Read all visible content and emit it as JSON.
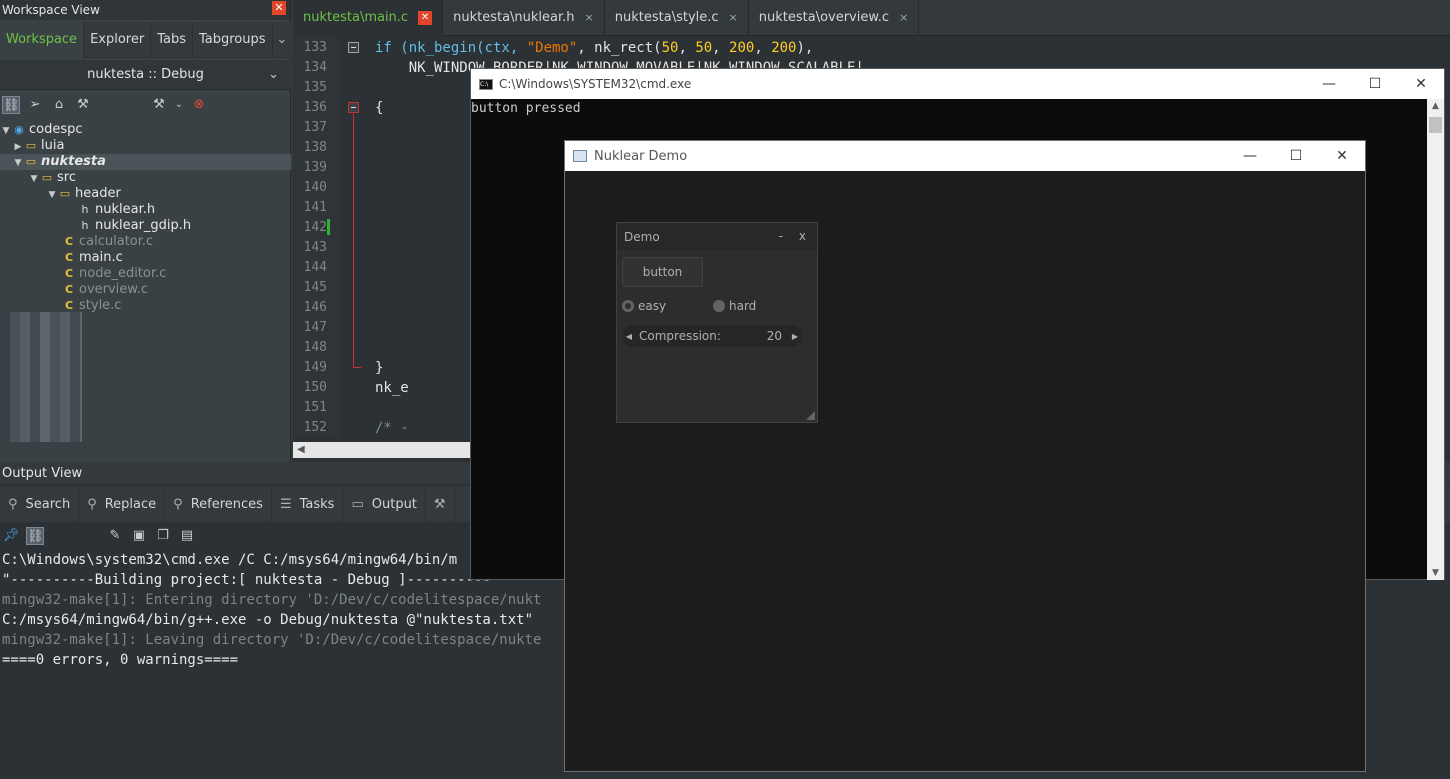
{
  "workspace": {
    "title": "Workspace View",
    "close_glyph": "✕",
    "tabs": [
      "Workspace",
      "Explorer",
      "Tabs",
      "Tabgroups"
    ],
    "tabs_more_glyph": "⌄",
    "project_selector": "nuktesta :: Debug",
    "project_selector_arrow": "⌄",
    "toolbar_icons": [
      "link-icon",
      "paper-plane-icon",
      "home-icon",
      "wrench-icon",
      "hammer-icon",
      "stop-icon"
    ],
    "tree": [
      {
        "label": "codespc",
        "icon": "project-icon",
        "expanded": true
      },
      {
        "label": "luia",
        "icon": "folder-icon",
        "expanded": false
      },
      {
        "label": "nuktesta",
        "icon": "folder-icon",
        "expanded": true
      },
      {
        "label": "src",
        "icon": "folder-icon",
        "expanded": true
      },
      {
        "label": "header",
        "icon": "folder-icon",
        "expanded": true
      },
      {
        "label": "nuklear.h",
        "icon": "h-file-icon"
      },
      {
        "label": "nuklear_gdip.h",
        "icon": "h-file-icon"
      },
      {
        "label": "calculator.c",
        "icon": "c-file-icon"
      },
      {
        "label": "main.c",
        "icon": "c-file-icon"
      },
      {
        "label": "node_editor.c",
        "icon": "c-file-icon"
      },
      {
        "label": "overview.c",
        "icon": "c-file-icon"
      },
      {
        "label": "style.c",
        "icon": "c-file-icon"
      }
    ]
  },
  "editor": {
    "tabs": [
      {
        "label": "nuktesta\\main.c",
        "close": "✕"
      },
      {
        "label": "nuktesta\\nuklear.h",
        "close": "×"
      },
      {
        "label": "nuktesta\\style.c",
        "close": "×"
      },
      {
        "label": "nuktesta\\overview.c",
        "close": "×"
      }
    ],
    "line_numbers": [
      "133",
      "134",
      "135",
      "136",
      "137",
      "138",
      "139",
      "140",
      "141",
      "142",
      "143",
      "144",
      "145",
      "146",
      "147",
      "148",
      "149",
      "150",
      "151",
      "152"
    ],
    "code": {
      "l133_a": "if (nk_begin(ctx, ",
      "l133_str": "\"Demo\"",
      "l133_b": ", nk_rect(",
      "l133_n1": "50",
      "l133_c1": ", ",
      "l133_n2": "50",
      "l133_c2": ", ",
      "l133_n3": "200",
      "l133_c3": ", ",
      "l133_n4": "200",
      "l133_d": "),",
      "l134": "    NK_WINDOW_BORDER|NK_WINDOW_MOVABLE|NK_WINDOW_SCALABLE|",
      "l136": "{",
      "l149": "}",
      "l150": "nk_e",
      "l152": "/* -"
    },
    "hscroll_glyph": "◀"
  },
  "output": {
    "title": "Output View",
    "tabs": [
      {
        "label": "Search",
        "icon": "search-icon"
      },
      {
        "label": "Replace",
        "icon": "replace-icon"
      },
      {
        "label": "References",
        "icon": "references-icon"
      },
      {
        "label": "Tasks",
        "icon": "tasks-icon"
      },
      {
        "label": "Output",
        "icon": "output-icon"
      }
    ],
    "build_icon": "hammer-icon",
    "lines": [
      "C:\\Windows\\system32\\cmd.exe /C C:/msys64/mingw64/bin/m",
      "\"----------Building project:[ nuktesta - Debug ]----------",
      "mingw32-make[1]: Entering directory 'D:/Dev/c/codelitespace/nukt",
      "C:/msys64/mingw64/bin/g++.exe -o Debug/nuktesta @\"nuktesta.txt\"",
      "mingw32-make[1]: Leaving directory 'D:/Dev/c/codelitespace/nukte",
      "====0 errors, 0 warnings===="
    ],
    "dim_lines": [
      2,
      4
    ]
  },
  "cmd": {
    "title": "C:\\Windows\\SYSTEM32\\cmd.exe",
    "icon_text": "C:\\",
    "min": "—",
    "max": "☐",
    "close": "✕",
    "text": "button pressed",
    "scroll_up": "▲",
    "scroll_down": "▼"
  },
  "nuklear": {
    "title": "Nuklear Demo",
    "min": "—",
    "max": "☐",
    "close": "✕",
    "panel": {
      "title": "Demo",
      "minimize": "-",
      "close": "x",
      "button_label": "button",
      "radio_easy": "easy",
      "radio_hard": "hard",
      "selected_radio": "easy",
      "property_label": "Compression:",
      "property_value": "20",
      "property_left": "◀",
      "property_right": "▶"
    }
  },
  "colors": {
    "accent_green": "#6fc146",
    "close_red": "#e0462a",
    "string_orange": "#ec7600",
    "number_yellow": "#ffcd22",
    "keyword_blue": "#66bde6"
  }
}
